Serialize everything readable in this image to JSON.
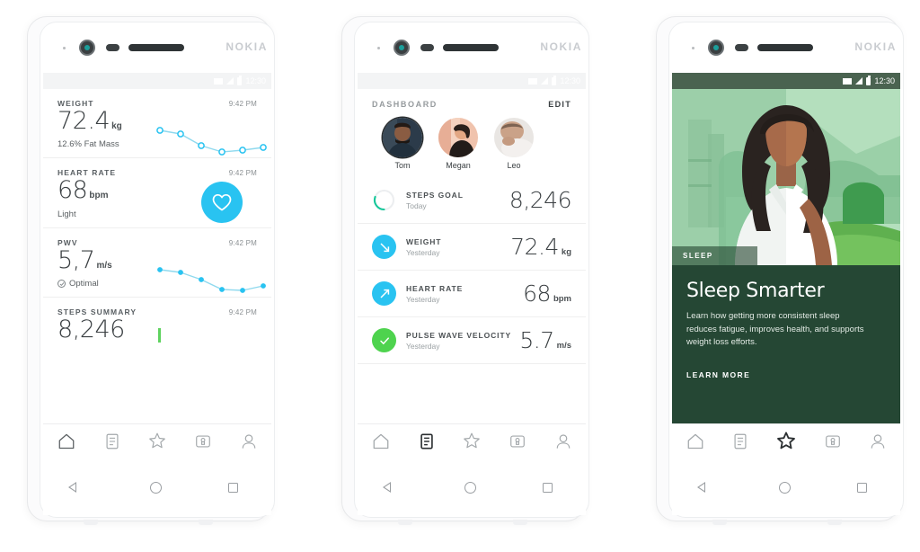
{
  "device": {
    "brand": "NOKIA"
  },
  "status_bar": {
    "time": "12:30",
    "icons": [
      "wifi-icon",
      "signal-icon",
      "battery-icon"
    ]
  },
  "hardware_nav": {
    "back": "back-triangle-icon",
    "home": "home-circle-icon",
    "recents": "recents-square-icon"
  },
  "colors": {
    "cyan": "#29c3f1",
    "green": "#4ed34e",
    "teal": "#16c79a",
    "dark_green": "#254734",
    "text": "#3b4043",
    "muted": "#9aa0a3"
  },
  "tabbar": {
    "items": [
      {
        "name": "home-icon",
        "label": "Home"
      },
      {
        "name": "timeline-icon",
        "label": "Timeline"
      },
      {
        "name": "star-icon",
        "label": "Programs"
      },
      {
        "name": "device-icon",
        "label": "Devices"
      },
      {
        "name": "profile-icon",
        "label": "Profile"
      }
    ],
    "active": {
      "phone1": 0,
      "phone2": 1,
      "phone3": 2
    }
  },
  "phone1": {
    "cards": [
      {
        "label": "WEIGHT",
        "time": "9:42 PM",
        "value": "72.4",
        "unit": "kg",
        "footer": "12.6% Fat Mass",
        "chart": {
          "type": "line",
          "marker": "hollow",
          "values": [
            72.9,
            72.8,
            72.5,
            72.3,
            72.35,
            72.4
          ]
        }
      },
      {
        "label": "HEART RATE",
        "time": "9:42 PM",
        "value": "68",
        "unit": "bpm",
        "footer": "Light",
        "badge_icon": "heart-icon"
      },
      {
        "label": "PWV",
        "time": "9:42 PM",
        "value": "5,7",
        "unit": "m/s",
        "footer": "Optimal",
        "footer_icon": "check-circle-icon",
        "chart": {
          "type": "line",
          "marker": "filled",
          "values": [
            5.9,
            5.88,
            5.8,
            5.65,
            5.66,
            5.72
          ]
        }
      },
      {
        "label": "STEPS SUMMARY",
        "time": "9:42 PM",
        "value": "8,246",
        "unit": ""
      }
    ]
  },
  "phone2": {
    "header": {
      "title": "DASHBOARD",
      "edit": "EDIT"
    },
    "people": [
      {
        "name": "Tom",
        "selected": true
      },
      {
        "name": "Megan",
        "selected": false
      },
      {
        "name": "Leo",
        "selected": false
      }
    ],
    "rows": [
      {
        "title": "STEPS GOAL",
        "sub": "Today",
        "value": "8,246",
        "unit": "",
        "icon": "progress-ring-icon",
        "icon_color": "#16c79a"
      },
      {
        "title": "WEIGHT",
        "sub": "Yesterday",
        "value": "72.4",
        "unit": "kg",
        "icon": "arrow-down-right-icon",
        "icon_color": "#29c3f1"
      },
      {
        "title": "HEART RATE",
        "sub": "Yesterday",
        "value": "68",
        "unit": "bpm",
        "icon": "arrow-up-right-icon",
        "icon_color": "#29c3f1"
      },
      {
        "title": "PULSE WAVE VELOCITY",
        "sub": "Yesterday",
        "value": "5.7",
        "unit": "m/s",
        "icon": "check-icon",
        "icon_color": "#4ed34e"
      }
    ]
  },
  "phone3": {
    "hero": {
      "tag": "SLEEP",
      "illustration": "woman-in-white-shirt-illustration"
    },
    "article": {
      "title": "Sleep Smarter",
      "body": "Learn how getting more consistent sleep reduces fatigue, improves health, and supports weight loss efforts.",
      "cta": "LEARN MORE"
    }
  }
}
